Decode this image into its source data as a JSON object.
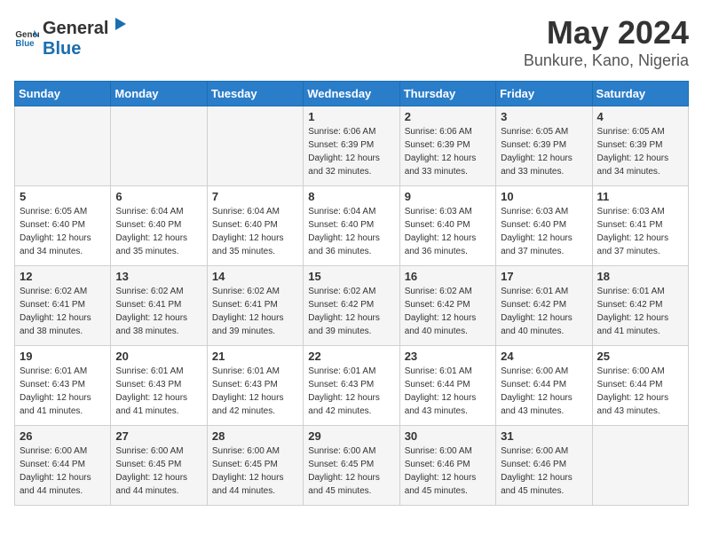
{
  "header": {
    "logo_general": "General",
    "logo_blue": "Blue",
    "title": "May 2024",
    "subtitle": "Bunkure, Kano, Nigeria"
  },
  "columns": [
    "Sunday",
    "Monday",
    "Tuesday",
    "Wednesday",
    "Thursday",
    "Friday",
    "Saturday"
  ],
  "weeks": [
    [
      {
        "day": "",
        "info": ""
      },
      {
        "day": "",
        "info": ""
      },
      {
        "day": "",
        "info": ""
      },
      {
        "day": "1",
        "info": "Sunrise: 6:06 AM\nSunset: 6:39 PM\nDaylight: 12 hours\nand 32 minutes."
      },
      {
        "day": "2",
        "info": "Sunrise: 6:06 AM\nSunset: 6:39 PM\nDaylight: 12 hours\nand 33 minutes."
      },
      {
        "day": "3",
        "info": "Sunrise: 6:05 AM\nSunset: 6:39 PM\nDaylight: 12 hours\nand 33 minutes."
      },
      {
        "day": "4",
        "info": "Sunrise: 6:05 AM\nSunset: 6:39 PM\nDaylight: 12 hours\nand 34 minutes."
      }
    ],
    [
      {
        "day": "5",
        "info": "Sunrise: 6:05 AM\nSunset: 6:40 PM\nDaylight: 12 hours\nand 34 minutes."
      },
      {
        "day": "6",
        "info": "Sunrise: 6:04 AM\nSunset: 6:40 PM\nDaylight: 12 hours\nand 35 minutes."
      },
      {
        "day": "7",
        "info": "Sunrise: 6:04 AM\nSunset: 6:40 PM\nDaylight: 12 hours\nand 35 minutes."
      },
      {
        "day": "8",
        "info": "Sunrise: 6:04 AM\nSunset: 6:40 PM\nDaylight: 12 hours\nand 36 minutes."
      },
      {
        "day": "9",
        "info": "Sunrise: 6:03 AM\nSunset: 6:40 PM\nDaylight: 12 hours\nand 36 minutes."
      },
      {
        "day": "10",
        "info": "Sunrise: 6:03 AM\nSunset: 6:40 PM\nDaylight: 12 hours\nand 37 minutes."
      },
      {
        "day": "11",
        "info": "Sunrise: 6:03 AM\nSunset: 6:41 PM\nDaylight: 12 hours\nand 37 minutes."
      }
    ],
    [
      {
        "day": "12",
        "info": "Sunrise: 6:02 AM\nSunset: 6:41 PM\nDaylight: 12 hours\nand 38 minutes."
      },
      {
        "day": "13",
        "info": "Sunrise: 6:02 AM\nSunset: 6:41 PM\nDaylight: 12 hours\nand 38 minutes."
      },
      {
        "day": "14",
        "info": "Sunrise: 6:02 AM\nSunset: 6:41 PM\nDaylight: 12 hours\nand 39 minutes."
      },
      {
        "day": "15",
        "info": "Sunrise: 6:02 AM\nSunset: 6:42 PM\nDaylight: 12 hours\nand 39 minutes."
      },
      {
        "day": "16",
        "info": "Sunrise: 6:02 AM\nSunset: 6:42 PM\nDaylight: 12 hours\nand 40 minutes."
      },
      {
        "day": "17",
        "info": "Sunrise: 6:01 AM\nSunset: 6:42 PM\nDaylight: 12 hours\nand 40 minutes."
      },
      {
        "day": "18",
        "info": "Sunrise: 6:01 AM\nSunset: 6:42 PM\nDaylight: 12 hours\nand 41 minutes."
      }
    ],
    [
      {
        "day": "19",
        "info": "Sunrise: 6:01 AM\nSunset: 6:43 PM\nDaylight: 12 hours\nand 41 minutes."
      },
      {
        "day": "20",
        "info": "Sunrise: 6:01 AM\nSunset: 6:43 PM\nDaylight: 12 hours\nand 41 minutes."
      },
      {
        "day": "21",
        "info": "Sunrise: 6:01 AM\nSunset: 6:43 PM\nDaylight: 12 hours\nand 42 minutes."
      },
      {
        "day": "22",
        "info": "Sunrise: 6:01 AM\nSunset: 6:43 PM\nDaylight: 12 hours\nand 42 minutes."
      },
      {
        "day": "23",
        "info": "Sunrise: 6:01 AM\nSunset: 6:44 PM\nDaylight: 12 hours\nand 43 minutes."
      },
      {
        "day": "24",
        "info": "Sunrise: 6:00 AM\nSunset: 6:44 PM\nDaylight: 12 hours\nand 43 minutes."
      },
      {
        "day": "25",
        "info": "Sunrise: 6:00 AM\nSunset: 6:44 PM\nDaylight: 12 hours\nand 43 minutes."
      }
    ],
    [
      {
        "day": "26",
        "info": "Sunrise: 6:00 AM\nSunset: 6:44 PM\nDaylight: 12 hours\nand 44 minutes."
      },
      {
        "day": "27",
        "info": "Sunrise: 6:00 AM\nSunset: 6:45 PM\nDaylight: 12 hours\nand 44 minutes."
      },
      {
        "day": "28",
        "info": "Sunrise: 6:00 AM\nSunset: 6:45 PM\nDaylight: 12 hours\nand 44 minutes."
      },
      {
        "day": "29",
        "info": "Sunrise: 6:00 AM\nSunset: 6:45 PM\nDaylight: 12 hours\nand 45 minutes."
      },
      {
        "day": "30",
        "info": "Sunrise: 6:00 AM\nSunset: 6:46 PM\nDaylight: 12 hours\nand 45 minutes."
      },
      {
        "day": "31",
        "info": "Sunrise: 6:00 AM\nSunset: 6:46 PM\nDaylight: 12 hours\nand 45 minutes."
      },
      {
        "day": "",
        "info": ""
      }
    ]
  ]
}
